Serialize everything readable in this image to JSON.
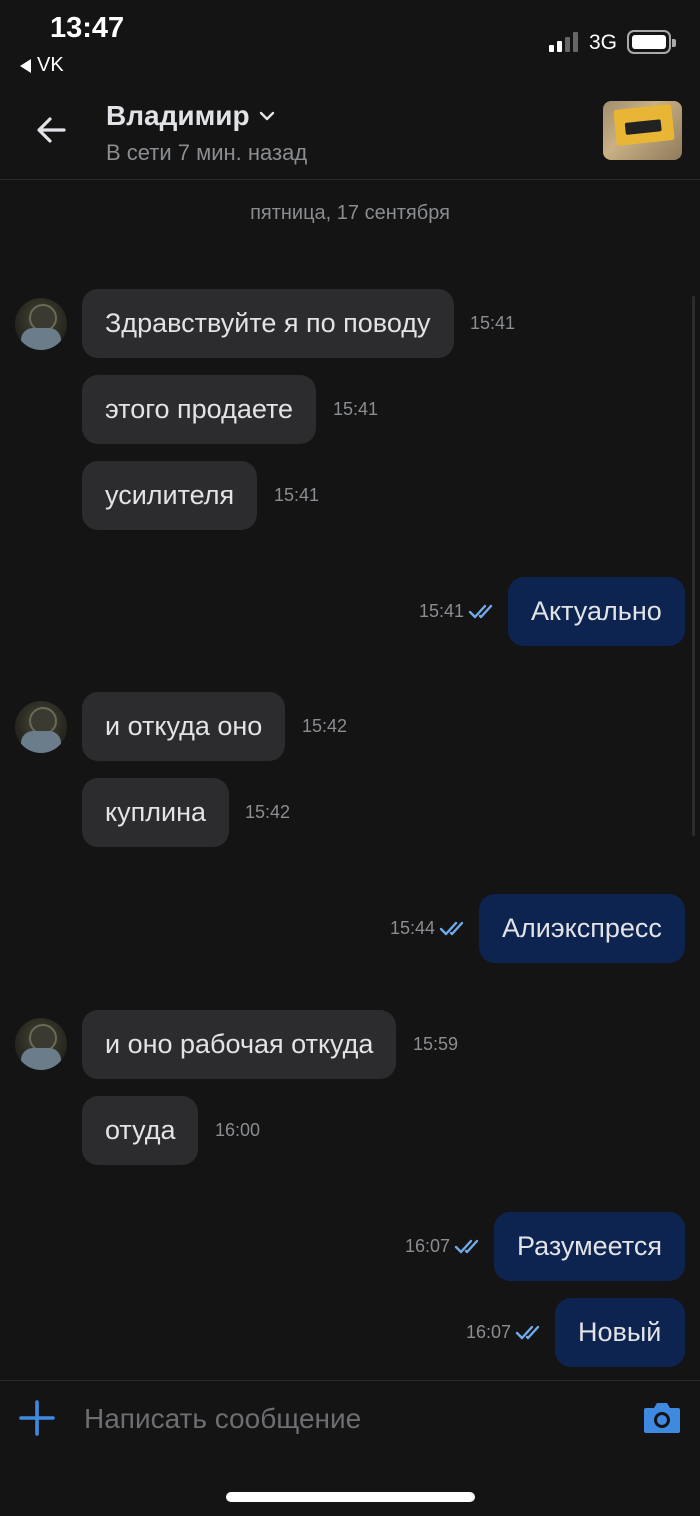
{
  "status_bar": {
    "time": "13:47",
    "back_app": "VK",
    "network": "3G"
  },
  "header": {
    "contact_name": "Владимир",
    "contact_status": "В сети 7 мин. назад"
  },
  "date_separator": "пятница, 17 сентября",
  "messages": [
    {
      "direction": "in",
      "text": "Здравствуйте я по поводу",
      "time": "15:41"
    },
    {
      "direction": "in",
      "text": "этого продаете",
      "time": "15:41"
    },
    {
      "direction": "in",
      "text": "усилителя",
      "time": "15:41"
    },
    {
      "direction": "out",
      "text": "Актуально",
      "time": "15:41",
      "read": true
    },
    {
      "direction": "in",
      "text": "и откуда оно",
      "time": "15:42"
    },
    {
      "direction": "in",
      "text": "куплина",
      "time": "15:42"
    },
    {
      "direction": "out",
      "text": "Алиэкспресс",
      "time": "15:44",
      "read": true
    },
    {
      "direction": "in",
      "text": "и оно рабочая откуда",
      "time": "15:59"
    },
    {
      "direction": "in",
      "text": "отуда",
      "time": "16:00"
    },
    {
      "direction": "out",
      "text": "Разумеется",
      "time": "16:07",
      "read": true
    },
    {
      "direction": "out",
      "text": "Новый",
      "time": "16:07",
      "read": true
    }
  ],
  "composer": {
    "placeholder": "Написать сообщение"
  },
  "colors": {
    "background": "#141414",
    "incoming_bubble": "#2c2c2e",
    "outgoing_bubble": "#0e2450",
    "accent": "#3f8ae0",
    "read_check": "#71aaeb"
  },
  "icons": {
    "back": "arrow-left-icon",
    "dropdown": "chevron-down-icon",
    "attach": "plus-icon",
    "camera": "camera-icon",
    "read": "double-check-icon"
  }
}
